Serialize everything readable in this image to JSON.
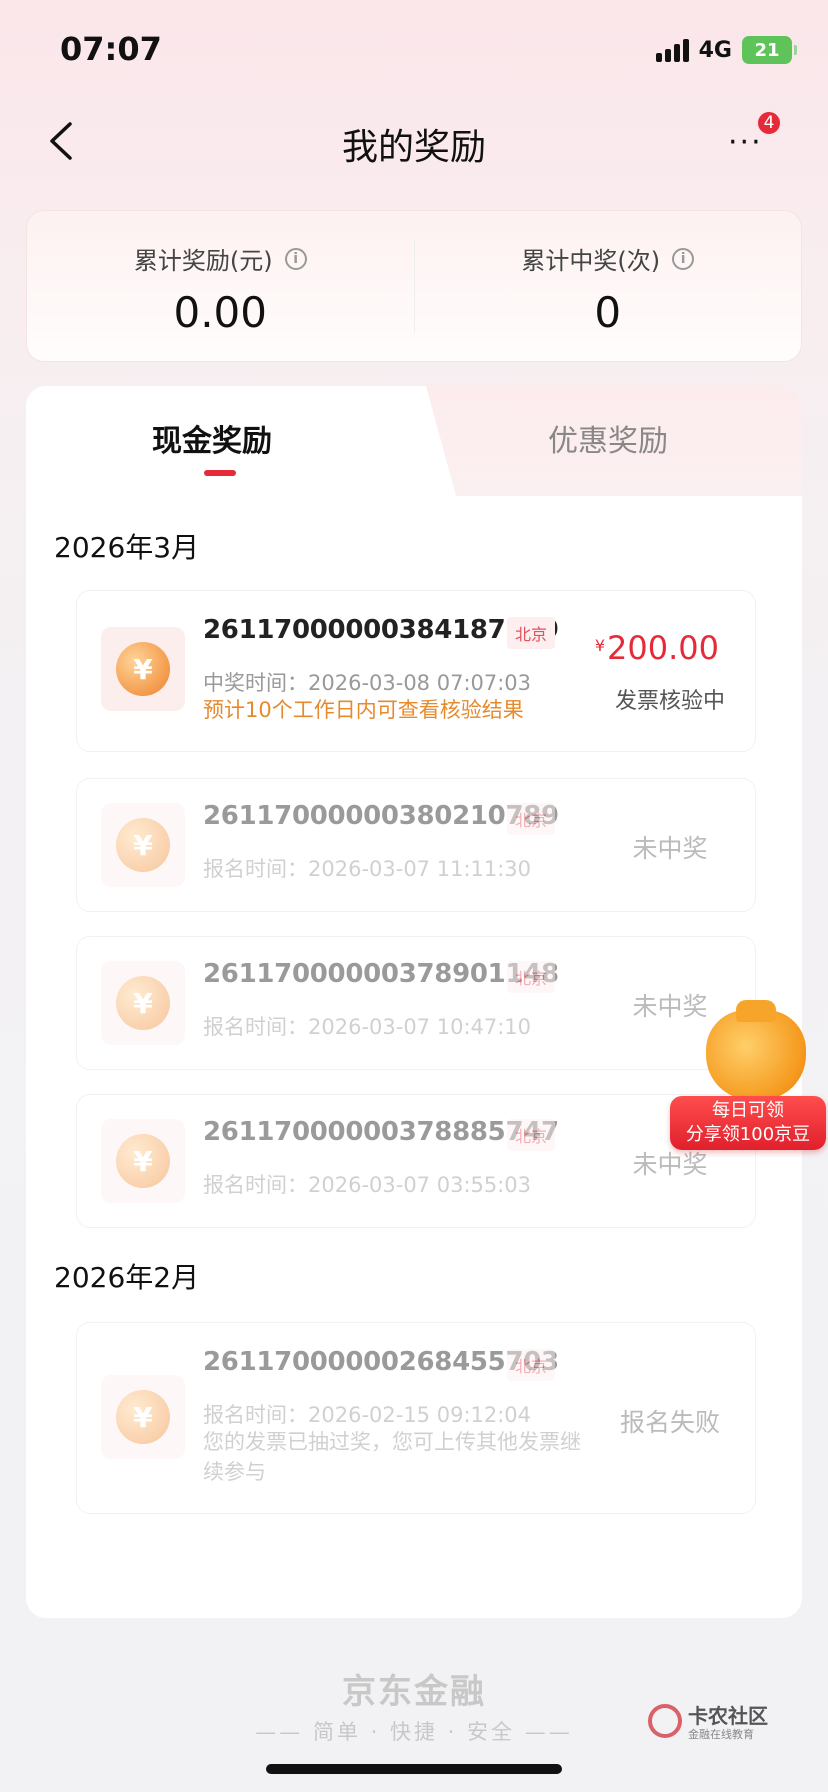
{
  "status_bar": {
    "time": "07:07",
    "network": "4G",
    "battery": "21"
  },
  "nav": {
    "title": "我的奖励",
    "badge": "4"
  },
  "summary": {
    "total_reward_label": "累计奖励(元)",
    "total_reward_value": "0.00",
    "total_wins_label": "累计中奖(次)",
    "total_wins_value": "0"
  },
  "tabs": {
    "cash": "现金奖励",
    "coupon": "优惠奖励"
  },
  "months": {
    "march": "2026年3月",
    "feb": "2026年2月"
  },
  "records": [
    {
      "id": "26117000000384187609",
      "tag": "北京",
      "time": "中奖时间：2026-03-08 07:07:03",
      "note": "预计10个工作日内可查看核验结果",
      "currency": "¥",
      "amount": "200.00",
      "status": "发票核验中"
    },
    {
      "id": "26117000000380210789",
      "tag": "北京",
      "time": "报名时间：2026-03-07 11:11:30",
      "status": "未中奖"
    },
    {
      "id": "26117000000378901148",
      "tag": "北京",
      "time": "报名时间：2026-03-07 10:47:10",
      "status": "未中奖"
    },
    {
      "id": "26117000000378885747",
      "tag": "北京",
      "time": "报名时间：2026-03-07 03:55:03",
      "status": "未中奖"
    },
    {
      "id": "26117000000268455703",
      "tag": "北京",
      "time": "报名时间：2026-02-15 09:12:04",
      "note": "您的发票已抽过奖，您可上传其他发票继续参与",
      "status": "报名失败"
    }
  ],
  "coin_symbol": "¥",
  "promo": {
    "line1": "每日可领",
    "line2": "分享领100京豆"
  },
  "footer": {
    "brand": "京东金融",
    "slogan": "—— 简单 · 快捷 · 安全 ——"
  },
  "watermark": {
    "name": "卡农社区",
    "sub": "金融在线教育"
  },
  "colors": {
    "accent": "#e52b3a",
    "note_orange": "#e68a2e"
  }
}
